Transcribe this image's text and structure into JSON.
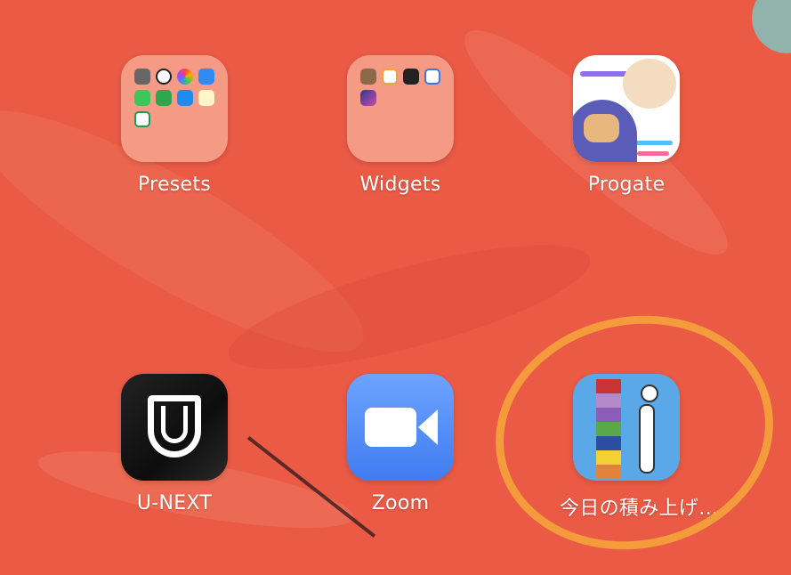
{
  "apps": [
    {
      "id": "presets",
      "label": "Presets",
      "type": "folder"
    },
    {
      "id": "widgets",
      "label": "Widgets",
      "type": "folder"
    },
    {
      "id": "progate",
      "label": "Progate",
      "type": "app"
    },
    {
      "id": "unext",
      "label": "U-NEXT",
      "type": "app"
    },
    {
      "id": "zoom",
      "label": "Zoom",
      "type": "app"
    },
    {
      "id": "tsumiage",
      "label": "今日の積み上げ…",
      "type": "app"
    }
  ],
  "colors": {
    "wallpaper": "#ea5a45",
    "folder": "#f59a84",
    "annotation_circle": "#f5a23a"
  }
}
